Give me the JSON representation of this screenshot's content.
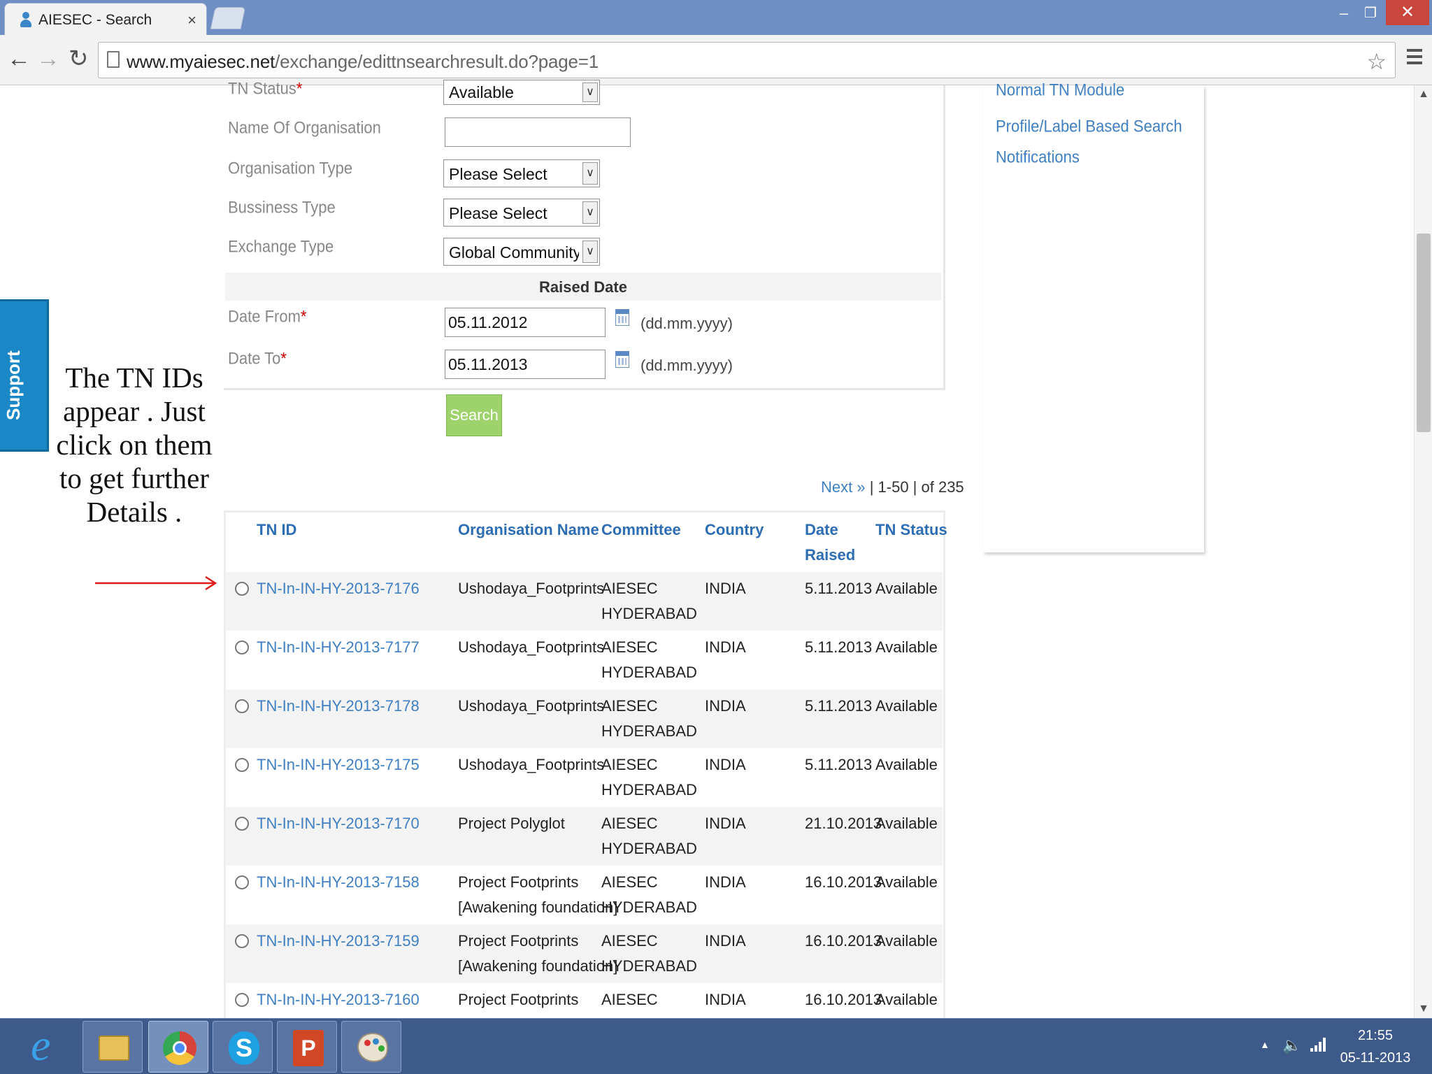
{
  "browser": {
    "tab_title": "AIESEC - Search",
    "tab_close": "×",
    "url_host": "www.myaiesec.net",
    "url_path": "/exchange/edittnsearchresult.do?page=1",
    "window_controls": {
      "minimize": "–",
      "maximize": "❐",
      "close": "✕"
    }
  },
  "support_tab": "Support",
  "annotation": {
    "text": "The TN IDs appear . Just click on them to get further Details .",
    "color": "#dd1c1c"
  },
  "form": {
    "tn_status": {
      "label": "TN Status",
      "required": "*",
      "value": "Available"
    },
    "org_name": {
      "label": "Name Of Organisation",
      "value": ""
    },
    "org_type": {
      "label": "Organisation Type",
      "value": "Please Select"
    },
    "business_type": {
      "label": "Bussiness Type",
      "value": "Please Select"
    },
    "exchange_type": {
      "label": "Exchange Type",
      "value": "Global Community Development"
    },
    "raised_date_heading": "Raised Date",
    "date_from": {
      "label": "Date From",
      "required": "*",
      "value": "05.11.2012",
      "format": "(dd.mm.yyyy)"
    },
    "date_to": {
      "label": "Date To",
      "required": "*",
      "value": "05.11.2013",
      "format": "(dd.mm.yyyy)"
    },
    "search_button": "Search"
  },
  "pager": {
    "next": "Next »",
    "range": " | 1-50 | of 235"
  },
  "results": {
    "headers": {
      "tn_id": "TN ID",
      "org_name": "Organisation Name",
      "committee": "Committee",
      "country": "Country",
      "date_raised_1": "Date",
      "date_raised_2": "Raised",
      "tn_status": "TN Status"
    },
    "rows": [
      {
        "tn_id": "TN-In-IN-HY-2013-7176",
        "org_1": "Ushodaya_Footprints",
        "org_2": "",
        "committee_1": "AIESEC",
        "committee_2": "HYDERABAD",
        "country": "INDIA",
        "date": "5.11.2013",
        "status": "Available"
      },
      {
        "tn_id": "TN-In-IN-HY-2013-7177",
        "org_1": "Ushodaya_Footprints",
        "org_2": "",
        "committee_1": "AIESEC",
        "committee_2": "HYDERABAD",
        "country": "INDIA",
        "date": "5.11.2013",
        "status": "Available"
      },
      {
        "tn_id": "TN-In-IN-HY-2013-7178",
        "org_1": "Ushodaya_Footprints",
        "org_2": "",
        "committee_1": "AIESEC",
        "committee_2": "HYDERABAD",
        "country": "INDIA",
        "date": "5.11.2013",
        "status": "Available"
      },
      {
        "tn_id": "TN-In-IN-HY-2013-7175",
        "org_1": "Ushodaya_Footprints",
        "org_2": "",
        "committee_1": "AIESEC",
        "committee_2": "HYDERABAD",
        "country": "INDIA",
        "date": "5.11.2013",
        "status": "Available"
      },
      {
        "tn_id": "TN-In-IN-HY-2013-7170",
        "org_1": "Project Polyglot",
        "org_2": "",
        "committee_1": "AIESEC",
        "committee_2": "HYDERABAD",
        "country": "INDIA",
        "date": "21.10.2013",
        "status": "Available"
      },
      {
        "tn_id": "TN-In-IN-HY-2013-7158",
        "org_1": "Project Footprints",
        "org_2": "[Awakening foundation]",
        "committee_1": "AIESEC",
        "committee_2": "HYDERABAD",
        "country": "INDIA",
        "date": "16.10.2013",
        "status": "Available"
      },
      {
        "tn_id": "TN-In-IN-HY-2013-7159",
        "org_1": "Project Footprints",
        "org_2": "[Awakening foundation]",
        "committee_1": "AIESEC",
        "committee_2": "HYDERABAD",
        "country": "INDIA",
        "date": "16.10.2013",
        "status": "Available"
      },
      {
        "tn_id": "TN-In-IN-HY-2013-7160",
        "org_1": "Project Footprints",
        "org_2": "",
        "committee_1": "AIESEC",
        "committee_2": "",
        "country": "INDIA",
        "date": "16.10.2013",
        "status": "Available"
      }
    ]
  },
  "side_panel": {
    "links": [
      "Normal TN Module",
      "Profile/Label Based Search",
      "Notifications"
    ]
  },
  "taskbar": {
    "apps": [
      "internet-explorer",
      "file-explorer",
      "google-chrome",
      "skype",
      "powerpoint",
      "paint"
    ],
    "clock_time": "21:55",
    "clock_date": "05-11-2013"
  }
}
